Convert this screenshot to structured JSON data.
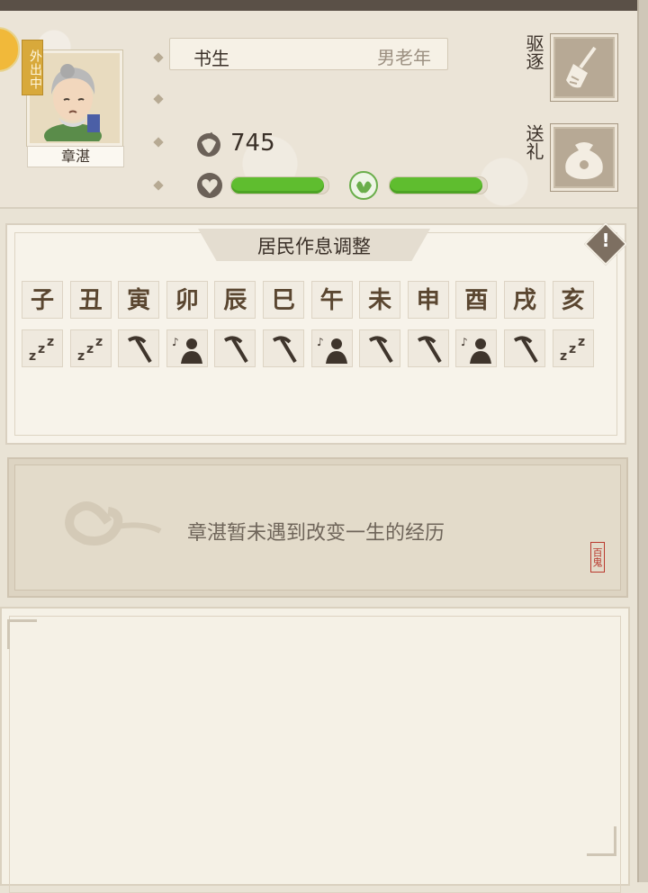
{
  "profile": {
    "status_tag": "外出中",
    "name": "章湛",
    "job": "书生",
    "age_group": "男老年",
    "coins": "745",
    "health_level": 0.95,
    "mood_level": 0.95,
    "actions": [
      {
        "label": "驱逐",
        "icon": "broom-icon"
      },
      {
        "label": "送礼",
        "icon": "gift-bag-icon"
      }
    ]
  },
  "schedule": {
    "title": "居民作息调整",
    "hours": [
      "子",
      "丑",
      "寅",
      "卯",
      "辰",
      "巳",
      "午",
      "未",
      "申",
      "酉",
      "戌",
      "亥"
    ],
    "activities": [
      "sleep",
      "sleep",
      "work",
      "rest",
      "work",
      "work",
      "rest",
      "work",
      "work",
      "rest",
      "work",
      "sleep"
    ]
  },
  "experience": {
    "text": "章湛暂未遇到改变一生的经历",
    "seal": "百鬼"
  },
  "colors": {
    "bar_fill": "#5fbd2f",
    "panel": "#f7f3ea",
    "accent_gold": "#d8a93b"
  }
}
